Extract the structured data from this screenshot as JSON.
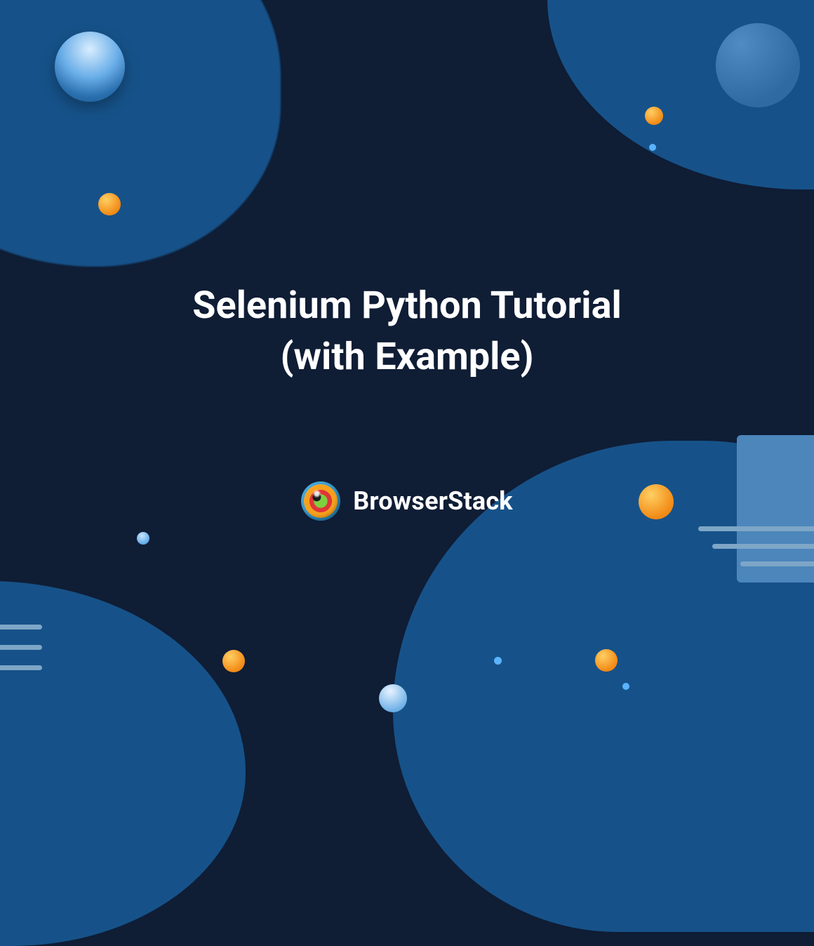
{
  "title_line1": "Selenium Python Tutorial",
  "title_line2": "(with Example)",
  "brand_name": "BrowserStack",
  "colors": {
    "background": "#0f1d35",
    "blob": "#165289",
    "accent_orange": "#f28a16",
    "accent_blue": "#59a6e6",
    "text": "#ffffff"
  }
}
